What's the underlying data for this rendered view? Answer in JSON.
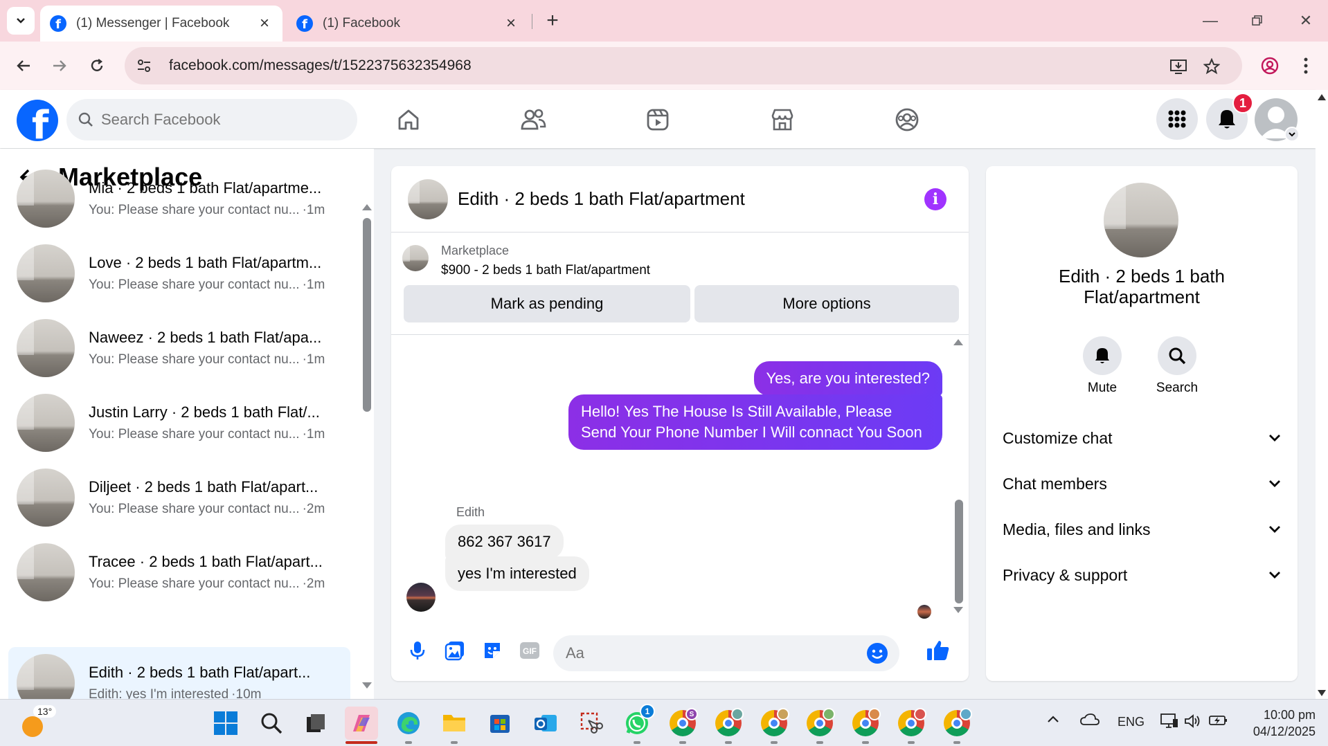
{
  "browser": {
    "tabs": [
      {
        "title": "(1) Messenger | Facebook",
        "active": true
      },
      {
        "title": "(1) Facebook",
        "active": false
      }
    ],
    "url": "facebook.com/messages/t/1522375632354968"
  },
  "facebook": {
    "search_placeholder": "Search Facebook",
    "notification_count": "1"
  },
  "sidebar": {
    "title": "Marketplace",
    "chats": [
      {
        "name": "Mia · 2 beds 1 bath Flat/apartme...",
        "preview": "You: Please share your contact nu...",
        "time": "·1m",
        "selected": false
      },
      {
        "name": "Love · 2 beds 1 bath Flat/apartm...",
        "preview": "You: Please share your contact nu...",
        "time": "·1m",
        "selected": false
      },
      {
        "name": "Naweez · 2 beds 1 bath Flat/apa...",
        "preview": "You: Please share your contact nu...",
        "time": "·1m",
        "selected": false
      },
      {
        "name": "Justin Larry · 2 beds 1 bath Flat/...",
        "preview": "You: Please share your contact nu...",
        "time": "·1m",
        "selected": false
      },
      {
        "name": "Diljeet · 2 beds 1 bath Flat/apart...",
        "preview": "You: Please share your contact nu...",
        "time": "·2m",
        "selected": false
      },
      {
        "name": "Tracee · 2 beds 1 bath Flat/apart...",
        "preview": "You: Please share your contact nu...",
        "time": "·2m",
        "selected": false
      },
      {
        "name": "Edith · 2 beds 1 bath Flat/apart...",
        "preview": "Edith: yes I'm interested",
        "time": "·10m",
        "selected": true
      }
    ]
  },
  "conversation": {
    "title": "Edith · 2 beds 1 bath Flat/apartment",
    "listing": {
      "source": "Marketplace",
      "title": "$900 - 2 beds 1 bath Flat/apartment",
      "mark_pending_label": "Mark as pending",
      "more_options_label": "More options"
    },
    "messages": [
      {
        "from": "me",
        "text": "Yes, are you interested?"
      },
      {
        "from": "me",
        "text": "Hello! Yes The House  Is Still Available, Please Send Your Phone Number I Will connact You Soon"
      },
      {
        "from": "Edith",
        "text": "862 367 3617"
      },
      {
        "from": "Edith",
        "text": "yes I'm interested"
      }
    ],
    "sender_name": "Edith",
    "composer_placeholder": "Aa"
  },
  "info_panel": {
    "name": "Edith · 2 beds 1 bath Flat/apartment",
    "actions": [
      {
        "label": "Mute",
        "icon": "bell-icon"
      },
      {
        "label": "Search",
        "icon": "search-icon"
      }
    ],
    "sections": [
      "Customize chat",
      "Chat members",
      "Media, files and links",
      "Privacy & support"
    ]
  },
  "taskbar": {
    "weather_temp": "13°",
    "whatsapp_badge": "1",
    "chrome_profile_badge": "S",
    "language": "ENG",
    "time": "10:00 pm",
    "date": "04/12/2025"
  },
  "colors": {
    "facebook_blue": "#0866ff",
    "messenger_purple": "#7b2ff7",
    "tabstrip_pink": "#f8d7de",
    "notification_red": "#e41e3f"
  }
}
